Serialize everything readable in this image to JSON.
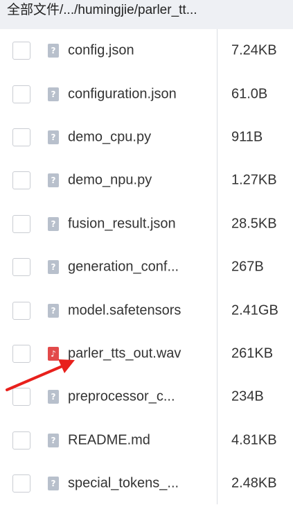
{
  "breadcrumb": {
    "text": "全部文件/.../humingjie/parler_tt..."
  },
  "files": [
    {
      "name": "config.json",
      "size": "7.24KB",
      "icon": "unknown-file-icon",
      "glyph": "?"
    },
    {
      "name": "configuration.json",
      "size": "61.0B",
      "icon": "unknown-file-icon",
      "glyph": "?"
    },
    {
      "name": "demo_cpu.py",
      "size": "911B",
      "icon": "unknown-file-icon",
      "glyph": "?"
    },
    {
      "name": "demo_npu.py",
      "size": "1.27KB",
      "icon": "unknown-file-icon",
      "glyph": "?"
    },
    {
      "name": "fusion_result.json",
      "size": "28.5KB",
      "icon": "unknown-file-icon",
      "glyph": "?"
    },
    {
      "name": "generation_conf...",
      "size": "267B",
      "icon": "unknown-file-icon",
      "glyph": "?"
    },
    {
      "name": "model.safetensors",
      "size": "2.41GB",
      "icon": "unknown-file-icon",
      "glyph": "?"
    },
    {
      "name": "parler_tts_out.wav",
      "size": "261KB",
      "icon": "audio-file-icon",
      "glyph": "♪"
    },
    {
      "name": "preprocessor_c...",
      "size": "234B",
      "icon": "unknown-file-icon",
      "glyph": "?"
    },
    {
      "name": "README.md",
      "size": "4.81KB",
      "icon": "unknown-file-icon",
      "glyph": "?"
    },
    {
      "name": "special_tokens_...",
      "size": "2.48KB",
      "icon": "unknown-file-icon",
      "glyph": "?"
    }
  ],
  "annotation": {
    "arrow_color": "#e8201c"
  },
  "colors": {
    "audio_icon": "#e24a4a",
    "generic_icon": "#b8c0cc",
    "breadcrumb_bg": "#eef0f4"
  }
}
